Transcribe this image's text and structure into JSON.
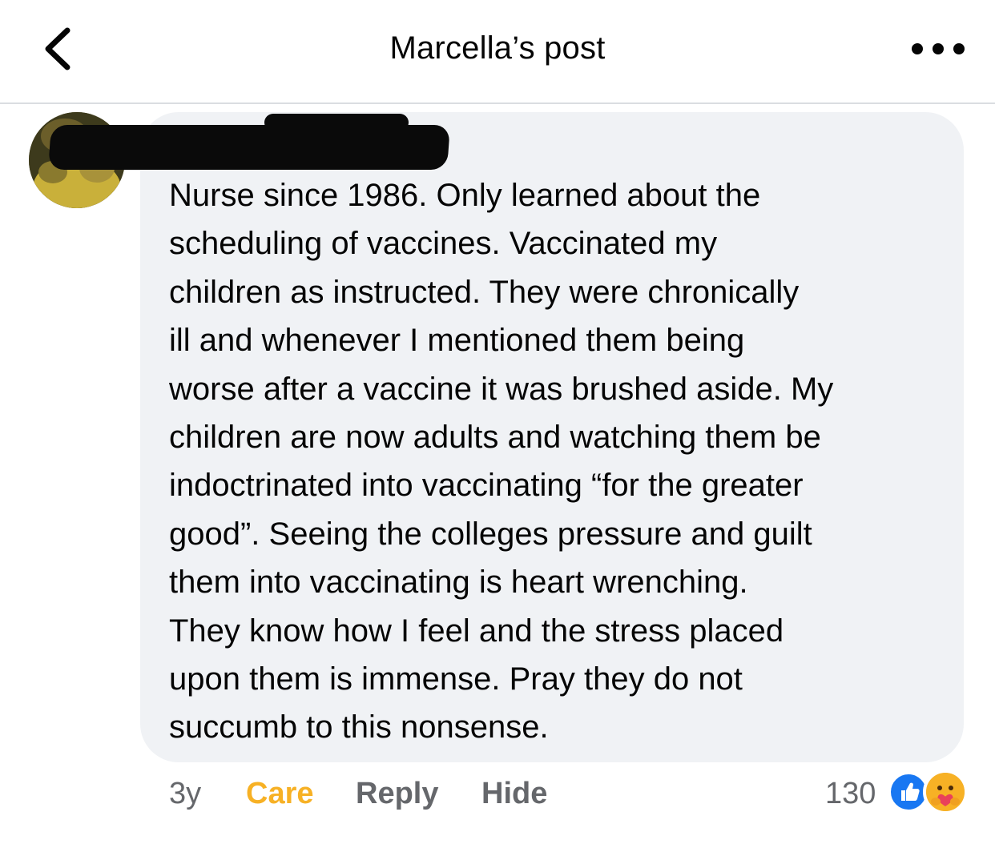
{
  "header": {
    "title": "Marcella’s post",
    "back_icon": "chevron-left-icon",
    "more_icon": "more-options-icon"
  },
  "comment": {
    "author_redacted": true,
    "text": "Nurse since 1986. Only learned about the\nscheduling of vaccines. Vaccinated my\nchildren as instructed.  They were chronically\nill and whenever I mentioned them being\nworse after a vaccine it was brushed aside. My\nchildren are now adults and watching them be\nindoctrinated into vaccinating “for the greater\ngood”. Seeing the colleges pressure and guilt\nthem into vaccinating is heart wrenching.\nThey know how I feel and the stress placed\nupon them is immense. Pray they do not\nsuccumb to this nonsense."
  },
  "actions": {
    "time": "3y",
    "care_label": "Care",
    "reply_label": "Reply",
    "hide_label": "Hide",
    "reaction_count": "130"
  },
  "colors": {
    "care_accent": "#f7b125",
    "like_blue": "#1877f2",
    "bubble_bg": "#f0f2f5",
    "secondary_text": "#65676b"
  }
}
